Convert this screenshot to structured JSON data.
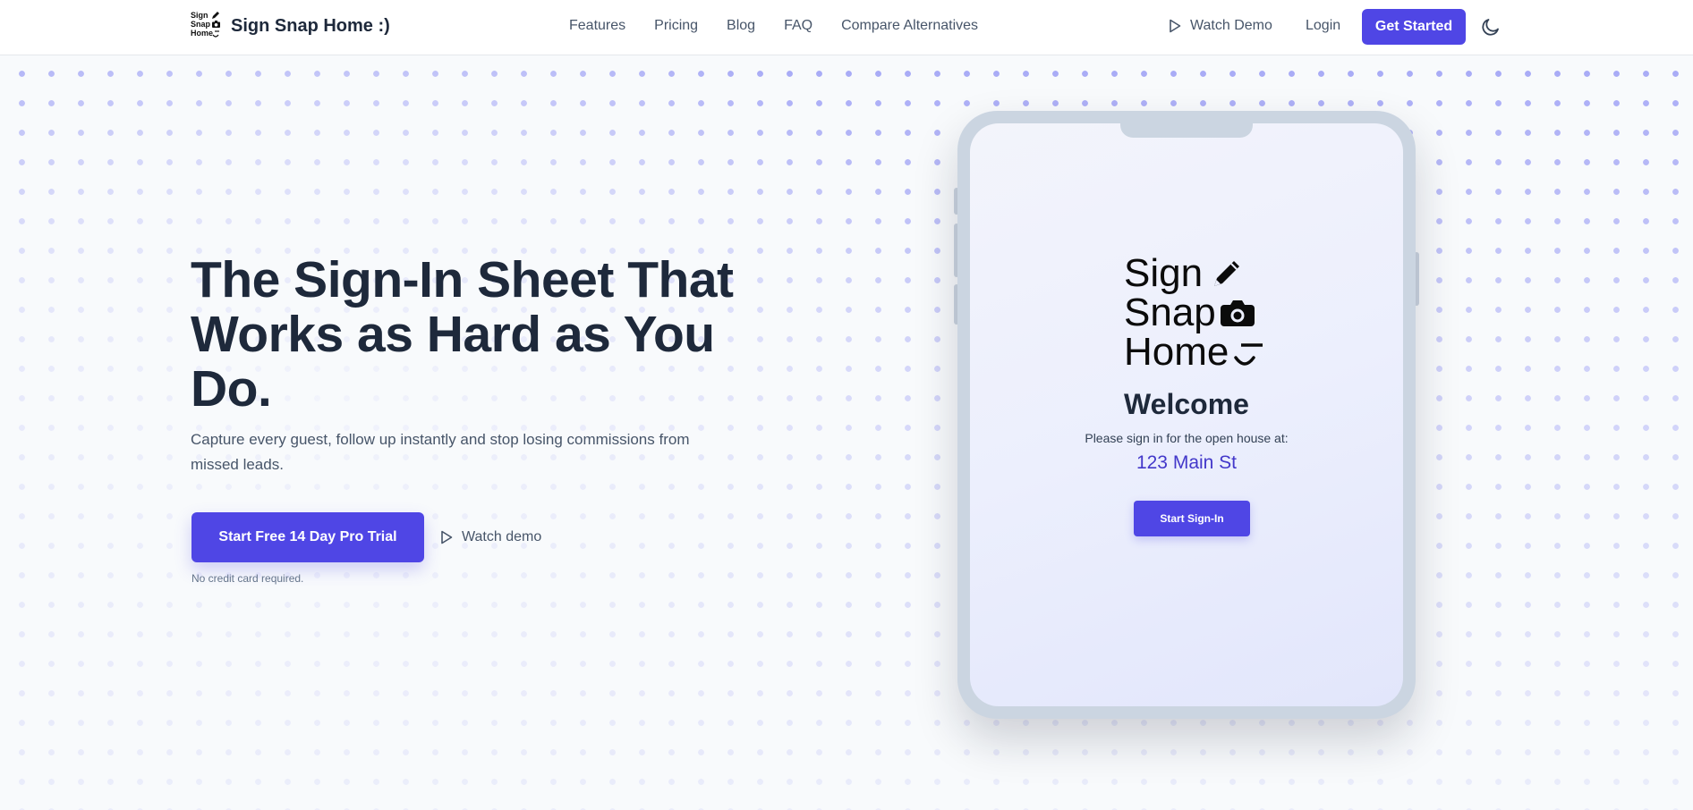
{
  "nav": {
    "logo_lines": [
      "Sign",
      "Snap",
      "Home"
    ],
    "brand_name": "Sign Snap Home :)",
    "links": [
      "Features",
      "Pricing",
      "Blog",
      "FAQ",
      "Compare Alternatives"
    ],
    "watch_demo": "Watch Demo",
    "login": "Login",
    "get_started": "Get Started"
  },
  "hero": {
    "title": "The Sign-In Sheet That Works as Hard as You Do.",
    "subtitle": "Capture every guest, follow up instantly and stop losing commissions from missed leads.",
    "cta": "Start Free 14 Day Pro Trial",
    "watch_demo": "Watch demo",
    "note": "No credit card required."
  },
  "tablet": {
    "logo_lines": [
      "Sign",
      "Snap",
      "Home"
    ],
    "welcome": "Welcome",
    "prompt": "Please sign in for the open house at:",
    "address": "123 Main St",
    "button": "Start Sign-In"
  },
  "colors": {
    "accent": "#4f46e5",
    "address": "#4338ca",
    "heading": "#1e293b",
    "body_text": "#475569",
    "tablet_frame": "#cbd5e1"
  },
  "icons": {
    "theme_toggle": "moon-icon",
    "watch_demo": "play-icon",
    "logo": [
      "pencil-icon",
      "camera-icon",
      "smile-icon"
    ]
  }
}
